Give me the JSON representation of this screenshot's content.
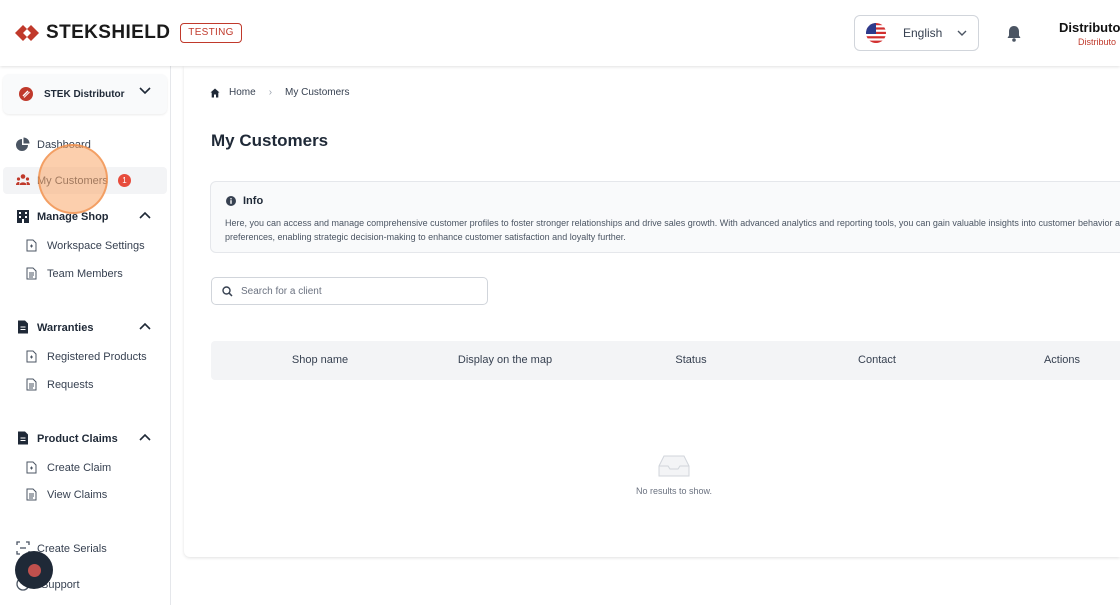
{
  "header": {
    "logo_text": "STEKSHIELD",
    "env_badge": "TESTING",
    "language": "English",
    "user_name": "Distributor",
    "user_role": "Distributo"
  },
  "sidebar": {
    "org_name": "STEK Distributor",
    "items": [
      {
        "label": "Dashboard"
      },
      {
        "label": "My Customers",
        "badge": "1"
      },
      {
        "label": "Manage Shop"
      },
      {
        "label": "Workspace Settings"
      },
      {
        "label": "Team Members"
      },
      {
        "label": "Warranties"
      },
      {
        "label": "Registered Products"
      },
      {
        "label": "Requests"
      },
      {
        "label": "Product Claims"
      },
      {
        "label": "Create Claim"
      },
      {
        "label": "View Claims"
      },
      {
        "label": "Create Serials"
      },
      {
        "label": "Support"
      }
    ]
  },
  "main": {
    "breadcrumb": {
      "home": "Home",
      "current": "My Customers"
    },
    "title": "My Customers",
    "info": {
      "title": "Info",
      "text": "Here, you can access and manage comprehensive customer profiles to foster stronger relationships and drive sales growth. With advanced analytics and reporting tools, you can gain valuable insights into customer behavior and preferences, enabling strategic decision-making to enhance customer satisfaction and loyalty further."
    },
    "search": {
      "placeholder": "Search for a client",
      "value": ""
    },
    "table": {
      "columns": [
        "Shop name",
        "Display on the map",
        "Status",
        "Contact",
        "Actions"
      ],
      "empty_text": "No results to show."
    }
  },
  "colors": {
    "brand_red": "#c0392b",
    "badge_red": "#e74c3c"
  },
  "icons": [
    "logo-icon",
    "us-flag-icon",
    "chevron-down-icon",
    "bell-icon",
    "org-icon",
    "pie-chart-icon",
    "users-icon",
    "building-icon",
    "document-icon",
    "file-icon",
    "scan-icon",
    "support-icon",
    "home-icon",
    "info-icon",
    "search-icon",
    "inbox-icon",
    "record-icon"
  ]
}
